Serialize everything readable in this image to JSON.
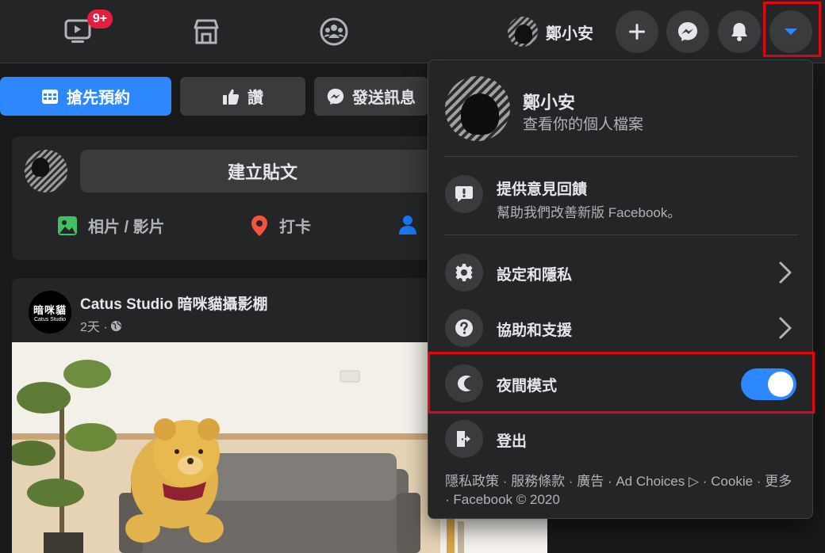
{
  "topbar": {
    "watch_badge": "9+",
    "profile_name": "鄭小安"
  },
  "page_actions": {
    "book_label": "搶先預約",
    "like_label": "讚",
    "message_label": "發送訊息"
  },
  "composer": {
    "create_post_label": "建立貼文",
    "photo_video_label": "相片 / 影片",
    "checkin_label": "打卡"
  },
  "post": {
    "page_name": "Catus Studio 暗咪貓攝影棚",
    "time": "2天 ·",
    "avatar_text_1": "暗咪貓",
    "avatar_text_2": "Catus Studio"
  },
  "menu": {
    "name": "鄭小安",
    "see_profile": "查看你的個人檔案",
    "feedback_title": "提供意見回饋",
    "feedback_sub": "幫助我們改善新版 Facebook。",
    "settings_label": "設定和隱私",
    "help_label": "協助和支援",
    "dark_mode_label": "夜間模式",
    "dark_mode_on": true,
    "logout_label": "登出",
    "footer_line1": "隱私政策 · 服務條款 · 廣告 · Ad Choices ▷ · Cookie · 更多",
    "footer_line2": "· Facebook © 2020"
  },
  "colors": {
    "accent": "#2d88ff",
    "highlight": "#e30613",
    "badge": "#e41e3f"
  }
}
